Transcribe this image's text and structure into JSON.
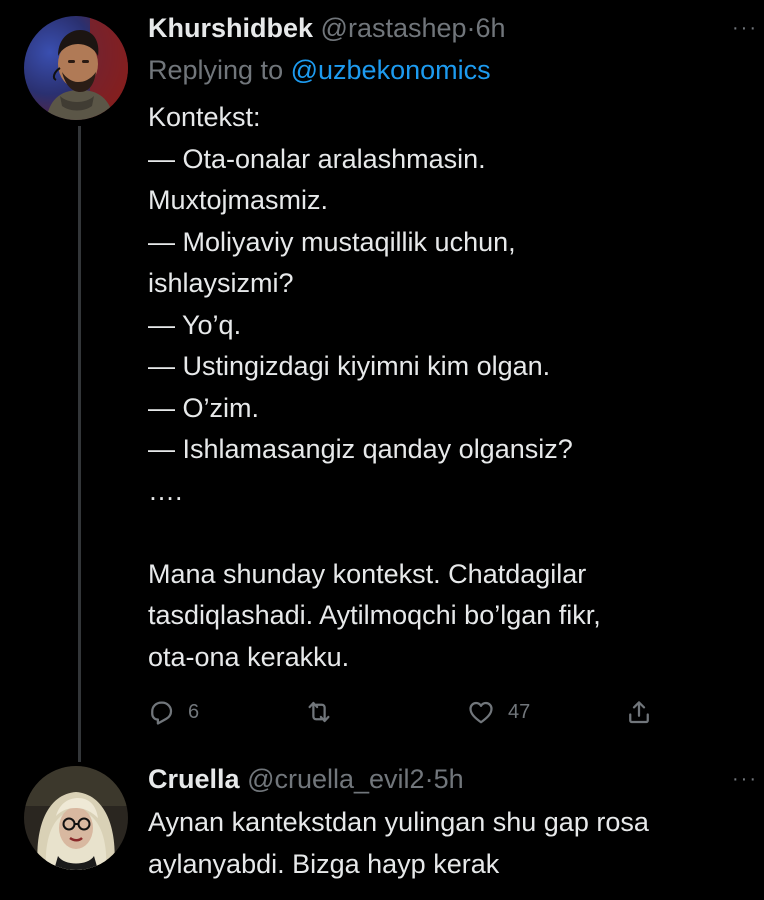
{
  "tweets": [
    {
      "display_name": "Khurshidbek",
      "handle": "@rastashep",
      "separator": "·",
      "time": "6h",
      "replying_prefix": "Replying to",
      "replying_to": "@uzbekonomics",
      "more_icon": "more-horizontal-icon",
      "lines": [
        "Kontekst:",
        "— Ota-onalar aralashmasin.",
        "Muxtojmasmiz.",
        "— Moliyaviy mustaqillik uchun,",
        "ishlaysizmi?",
        "— Yo’q.",
        "— Ustingizdagi kiyimni kim olgan.",
        "— O’zim.",
        "— Ishlamasangiz qanday olgansiz?",
        "….",
        "",
        "Mana shunday kontekst. Chatdagilar",
        "tasdiqlashadi. Aytilmoqchi bo’lgan fikr,",
        "ota-ona kerakku."
      ],
      "actions": {
        "reply_count": "6",
        "retweet_count": "",
        "like_count": "47",
        "share_count": ""
      }
    },
    {
      "display_name": "Cruella",
      "handle": "@cruella_evil2",
      "separator": "·",
      "time": "5h",
      "more_icon": "more-horizontal-icon",
      "lines": [
        "Aynan kantekstdan yulingan shu gap rosa",
        "aylanyabdi. Bizga hayp kerak"
      ]
    }
  ],
  "colors": {
    "background": "#000000",
    "text": "#e7e9ea",
    "secondary": "#71767b",
    "link": "#1d9bf0",
    "thread_line": "#333639"
  }
}
